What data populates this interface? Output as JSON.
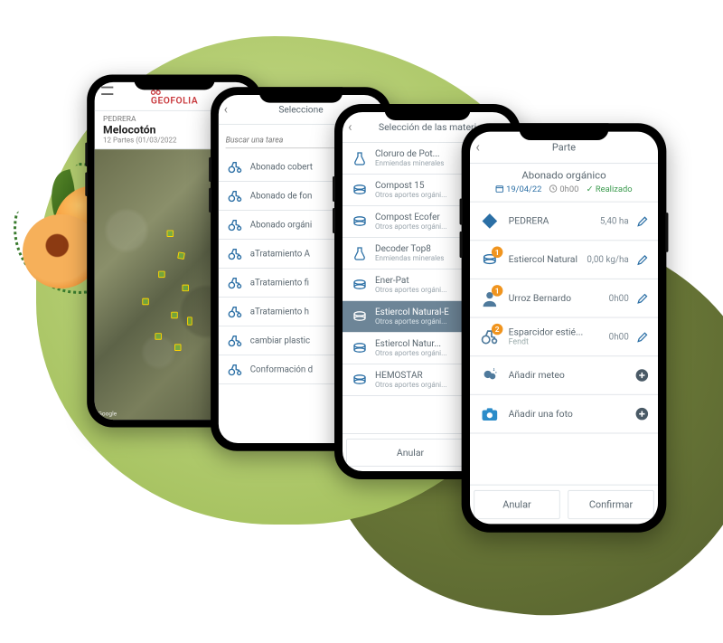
{
  "brand": "GEOFOLIA",
  "phone1": {
    "plot_name": "PEDRERA",
    "crop": "Melocotón",
    "subtitle": "12 Partes (01/03/2022",
    "map_credit": "Google"
  },
  "phone2": {
    "title": "Seleccione",
    "search_placeholder": "Buscar una tarea",
    "items": [
      "Abonado cobert",
      "Abonado de fon",
      "Abonado orgáni",
      "aTratamiento A",
      "aTratamiento fi",
      "aTratamiento h",
      "cambiar plastic",
      "Conformación d"
    ]
  },
  "phone3": {
    "title": "Selección de las materi",
    "items": [
      {
        "name": "Cloruro de Pot...",
        "sub": "Enmiendas minerales",
        "hl": false,
        "icon": "chem"
      },
      {
        "name": "Compost 15",
        "sub": "Otros aportes orgáni...",
        "hl": false,
        "icon": "disc"
      },
      {
        "name": "Compost Ecofer",
        "sub": "Otros aportes orgáni...",
        "hl": false,
        "icon": "disc"
      },
      {
        "name": "Decoder Top8",
        "sub": "Enmiendas minerales",
        "hl": false,
        "icon": "chem"
      },
      {
        "name": "Ener-Pat",
        "sub": "Otros aportes orgáni...",
        "hl": false,
        "icon": "disc"
      },
      {
        "name": "Estiercol Natural-E",
        "sub": "Otros aportes orgáni...",
        "hl": true,
        "icon": "disc"
      },
      {
        "name": "Estiercol Natur...",
        "sub": "Otros aportes orgáni...",
        "hl": false,
        "icon": "disc"
      },
      {
        "name": "HEMOSTAR",
        "sub": "Otros aportes orgáni...",
        "hl": false,
        "icon": "disc"
      }
    ],
    "cancel": "Anular"
  },
  "phone4": {
    "title": "Parte",
    "task": "Abonado orgánico",
    "date": "19/04/22",
    "duration": "0h00",
    "status": "Realizado",
    "rows": [
      {
        "icon": "plot",
        "badge": "",
        "label": "PEDRERA",
        "sub": "",
        "value": "5,40 ha"
      },
      {
        "icon": "product",
        "badge": "1",
        "label": "Estiercol Natural",
        "sub": "",
        "value": "0,00 kg/ha"
      },
      {
        "icon": "person",
        "badge": "1",
        "label": "Urroz Bernardo",
        "sub": "",
        "value": "0h00"
      },
      {
        "icon": "tractor",
        "badge": "2",
        "label": "Esparcidor estié...",
        "sub": "Fendt",
        "value": "0h00"
      }
    ],
    "add_weather": "Añadir meteo",
    "add_photo": "Añadir una foto",
    "cancel": "Anular",
    "confirm": "Confirmar"
  }
}
